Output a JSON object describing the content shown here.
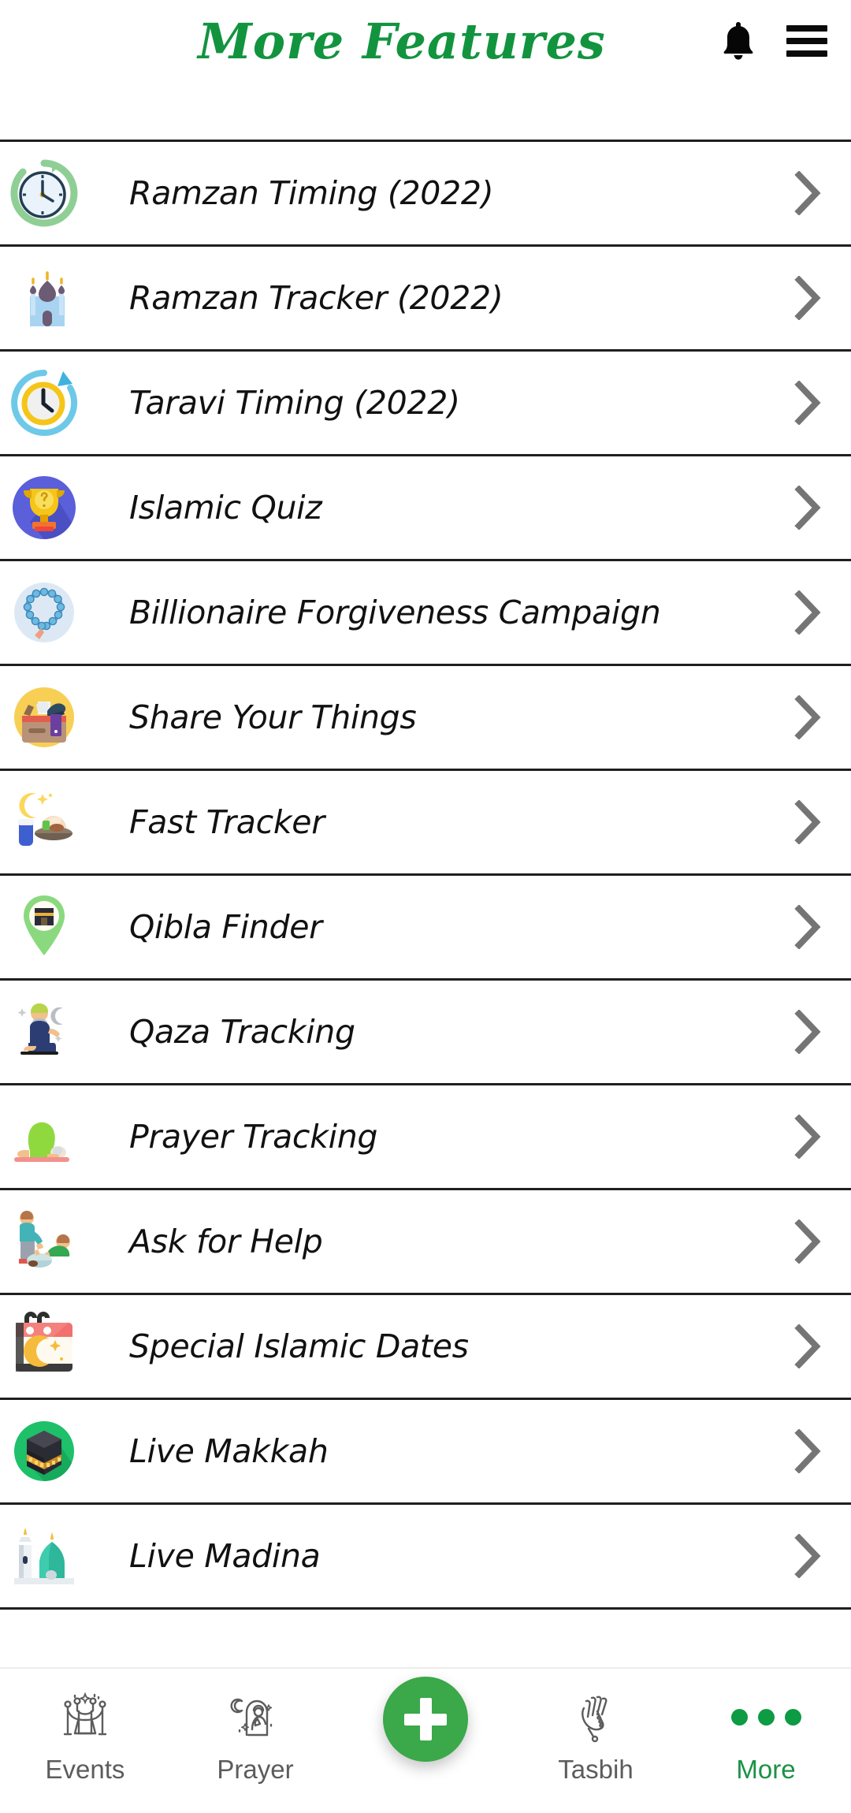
{
  "header": {
    "title": "More Features",
    "title_color": "#12943f",
    "notification_icon": "bell-icon",
    "menu_icon": "hamburger-menu-icon"
  },
  "features": [
    {
      "label": "Ramzan Timing (2022)",
      "icon": "stopwatch-clock-icon"
    },
    {
      "label": "Ramzan Tracker (2022)",
      "icon": "mosque-crescent-icon"
    },
    {
      "label": "Taravi Timing (2022)",
      "icon": "clock-refresh-icon"
    },
    {
      "label": "Islamic Quiz",
      "icon": "trophy-question-icon"
    },
    {
      "label": "Billionaire Forgiveness Campaign",
      "icon": "prayer-beads-icon"
    },
    {
      "label": "Share Your Things",
      "icon": "donation-box-icon"
    },
    {
      "label": "Fast Tracker",
      "icon": "iftar-meal-icon"
    },
    {
      "label": "Qibla Finder",
      "icon": "kaaba-location-pin-icon"
    },
    {
      "label": "Qaza Tracking",
      "icon": "praying-person-night-icon"
    },
    {
      "label": "Prayer Tracking",
      "icon": "sujood-person-icon"
    },
    {
      "label": "Ask for Help",
      "icon": "helping-hand-icon"
    },
    {
      "label": "Special Islamic Dates",
      "icon": "crescent-calendar-icon"
    },
    {
      "label": "Live Makkah",
      "icon": "kaaba-circle-icon"
    },
    {
      "label": "Live Madina",
      "icon": "green-dome-mosque-icon"
    }
  ],
  "bottom_nav": {
    "items": [
      {
        "label": "Events",
        "icon": "stanchion-rope-icon",
        "active": false
      },
      {
        "label": "Prayer",
        "icon": "praying-arch-icon",
        "active": false
      },
      {
        "label": "Tasbih",
        "icon": "dua-hands-icon",
        "active": false
      },
      {
        "label": "More",
        "icon": "three-dots-icon",
        "active": true
      }
    ],
    "fab": {
      "icon": "plus-icon",
      "color": "#3ba849"
    },
    "active_color": "#1a9245",
    "inactive_color": "#5c5c5c"
  }
}
